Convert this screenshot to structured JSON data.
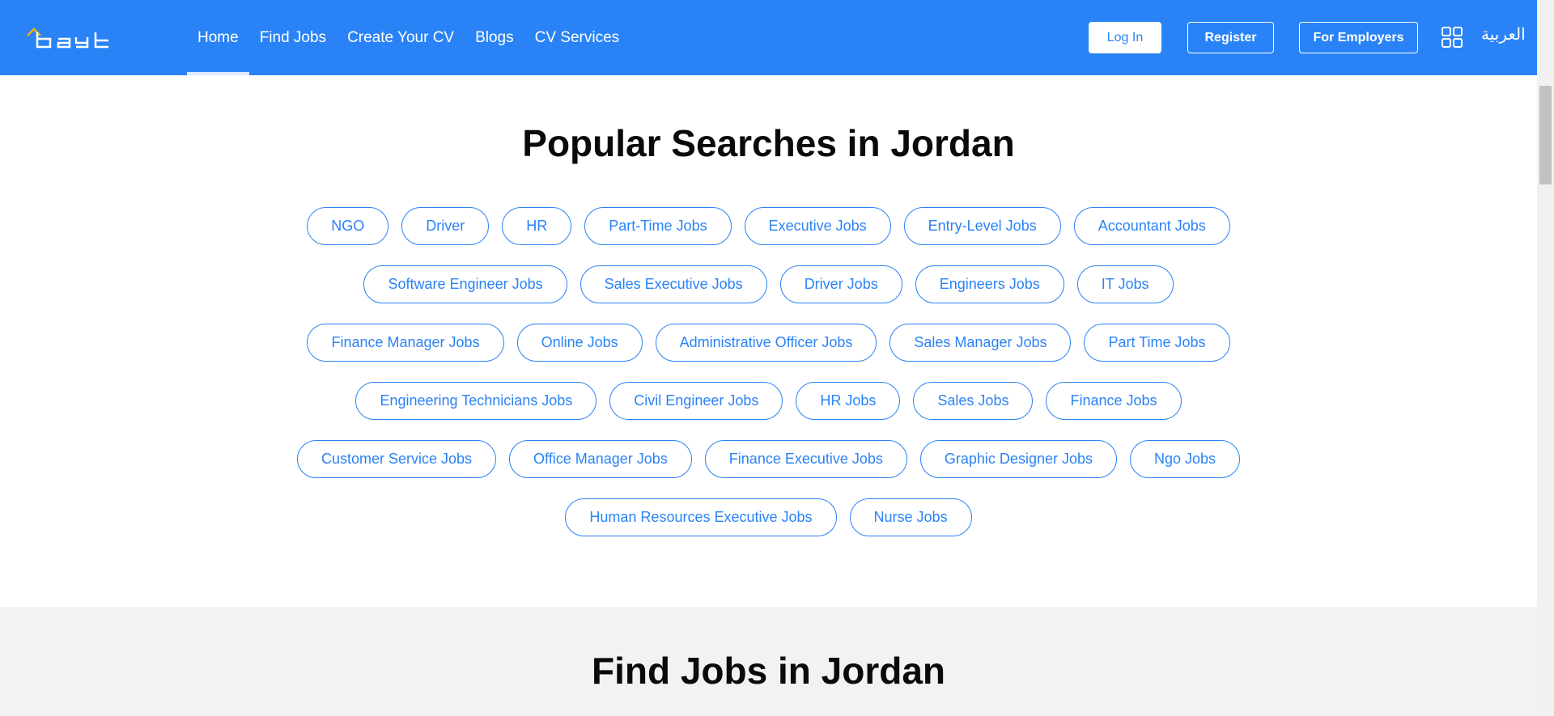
{
  "brand": {
    "logo_text": "bayt",
    "accent": "#2a83f6"
  },
  "nav": {
    "items": [
      "Home",
      "Find Jobs",
      "Create Your CV",
      "Blogs",
      "CV Services"
    ],
    "active": "Home"
  },
  "header_actions": {
    "login": "Log In",
    "register": "Register",
    "employers": "For Employers",
    "apps_icon": "grid-icon",
    "language": "العربية"
  },
  "popular": {
    "title": "Popular Searches in Jordan",
    "rows": [
      [
        "NGO",
        "Driver",
        "HR",
        "Part-Time Jobs",
        "Executive Jobs",
        "Entry-Level Jobs",
        "Accountant Jobs"
      ],
      [
        "Software Engineer Jobs",
        "Sales Executive Jobs",
        "Driver Jobs",
        "Engineers Jobs",
        "IT Jobs"
      ],
      [
        "Finance Manager Jobs",
        "Online Jobs",
        "Administrative Officer Jobs",
        "Sales Manager Jobs",
        "Part Time Jobs"
      ],
      [
        "Engineering Technicians Jobs",
        "Civil Engineer Jobs",
        "HR Jobs",
        "Sales Jobs",
        "Finance Jobs"
      ],
      [
        "Customer Service Jobs",
        "Office Manager Jobs",
        "Finance Executive Jobs",
        "Graphic Designer Jobs",
        "Ngo Jobs"
      ],
      [
        "Human Resources Executive Jobs",
        "Nurse Jobs"
      ]
    ]
  },
  "find_jobs": {
    "title": "Find Jobs in Jordan"
  }
}
